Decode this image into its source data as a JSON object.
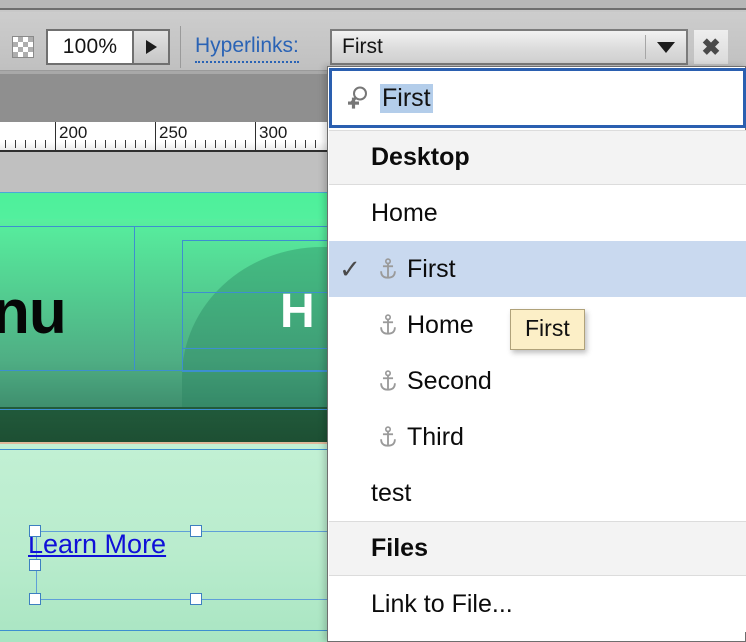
{
  "toolbar": {
    "transparency_icon": "checkerboard-icon",
    "zoom_value": "100%",
    "zoom_arrow_icon": "triangle-right-icon",
    "hyperlinks_label": "Hyperlinks:",
    "hyperlink_combo_value": "First",
    "combo_arrow_icon": "triangle-down-icon",
    "close_label": "✖"
  },
  "ruler": {
    "labels": [
      "200",
      "250",
      "300"
    ],
    "label_positions": [
      57,
      157,
      257
    ],
    "major_positions": [
      55,
      155,
      255
    ],
    "minor_spacing": 20
  },
  "canvas": {
    "hero_text_left": "nu",
    "hero_text_right": "H",
    "link_text": "Learn More",
    "link_color": "#1010d8",
    "guide_color": "#3d8fd0",
    "handle_color": "#ffffff"
  },
  "dropdown": {
    "search": {
      "icon": "search-plus-icon",
      "value": "First"
    },
    "sections": [
      {
        "header": "Desktop",
        "items": [
          {
            "label": "Home",
            "icon": null,
            "checked": false,
            "selected": false
          },
          {
            "label": "First",
            "icon": "anchor-icon",
            "checked": true,
            "selected": true
          },
          {
            "label": "Home",
            "icon": "anchor-icon",
            "checked": false,
            "selected": false
          },
          {
            "label": "Second",
            "icon": "anchor-icon",
            "checked": false,
            "selected": false
          },
          {
            "label": "Third",
            "icon": "anchor-icon",
            "checked": false,
            "selected": false
          },
          {
            "label": "test",
            "icon": null,
            "checked": false,
            "selected": false
          }
        ]
      },
      {
        "header": "Files",
        "items": [
          {
            "label": "Link to File...",
            "icon": null,
            "checked": false,
            "selected": false
          }
        ]
      }
    ],
    "checkmark": "✓"
  },
  "tooltip": {
    "text": "First"
  },
  "colors": {
    "selection_blue": "#c9d9ef",
    "text_selection_blue": "#b3cdea",
    "tooltip_yellow": "#fcefc7",
    "focus_border_blue": "#2a5fb0",
    "link_blue": "#2a63b5"
  }
}
